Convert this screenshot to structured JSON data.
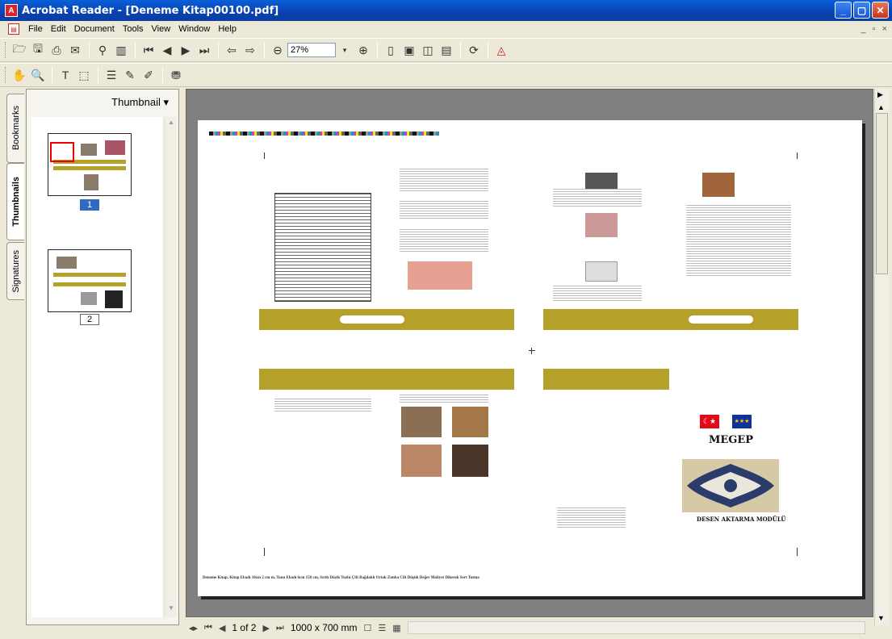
{
  "window": {
    "title": "Acrobat Reader - [Deneme Kitap00100.pdf]",
    "controls": [
      "_",
      "▢",
      "✕"
    ],
    "mdi_controls": [
      "_",
      "▫",
      "×"
    ]
  },
  "menu": [
    "File",
    "Edit",
    "Document",
    "Tools",
    "View",
    "Window",
    "Help"
  ],
  "toolbar": {
    "zoom_value": "27%"
  },
  "side_tabs": [
    "Bookmarks",
    "Thumbnails",
    "Signatures"
  ],
  "thumbnails": {
    "header": "Thumbnail ▾",
    "pages": [
      {
        "number": "1",
        "selected": true
      },
      {
        "number": "2",
        "selected": false
      }
    ]
  },
  "document": {
    "cover": {
      "logo_text": "MEGEP",
      "module_title": "DESEN AKTARMA MODÜLÜ"
    },
    "footer": "Deneme Kitap,  Kitap Ebadı  10cm 2 cm m,  Tonu Ebadı 6cm 150 cm,  Sırtlı Düzik  Tuzlu Çift Bağdaklı Ortak Zımba Cilt  Düşük Değer  Maliyet  Dikerek Sert Tutma"
  },
  "status_bar": {
    "page_indicator": "1 of 2",
    "page_size": "1000 x 700 mm"
  },
  "colors": {
    "titlebar": "#0842b0",
    "gold_band": "#b5a12a",
    "doc_background": "#808080"
  }
}
